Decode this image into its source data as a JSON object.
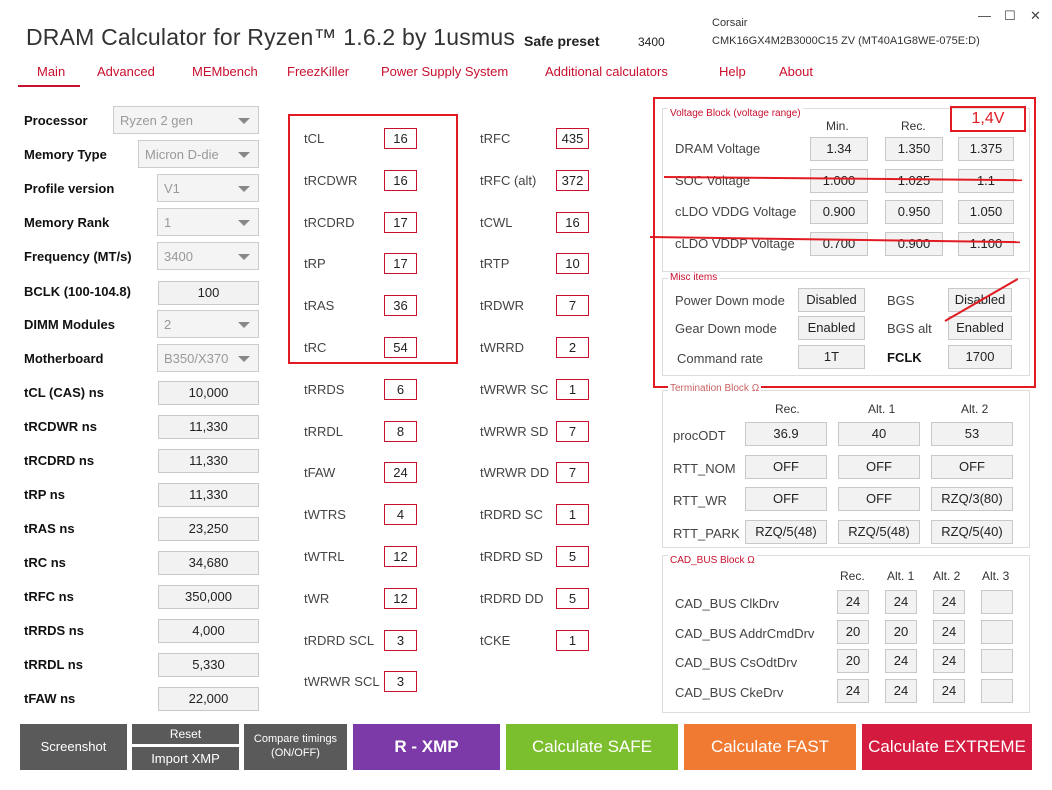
{
  "app": {
    "title": "DRAM Calculator for Ryzen™ 1.6.2 by 1usmus",
    "preset_label": "Safe preset",
    "preset_value": "3400",
    "module_vendor": "Corsair",
    "module_part": "CMK16GX4M2B3000C15  ZV (MT40A1G8WE-075E:D)"
  },
  "window": {
    "minimize": "—",
    "maximize": "☐",
    "close": "✕"
  },
  "tabs": [
    "Main",
    "Advanced",
    "MEMbench",
    "FreezKiller",
    "Power Supply System",
    "Additional calculators",
    "Help",
    "About"
  ],
  "settings": {
    "processor": {
      "label": "Processor",
      "value": "Ryzen 2 gen"
    },
    "memory_type": {
      "label": "Memory Type",
      "value": "Micron D-die"
    },
    "profile_version": {
      "label": "Profile version",
      "value": "V1"
    },
    "memory_rank": {
      "label": "Memory Rank",
      "value": "1"
    },
    "frequency": {
      "label": "Frequency (MT/s)",
      "value": "3400"
    },
    "bclk": {
      "label": "BCLK (100-104.8)",
      "value": "100"
    },
    "dimm_modules": {
      "label": "DIMM Modules",
      "value": "2"
    },
    "motherboard": {
      "label": "Motherboard",
      "value": "B350/X370"
    }
  },
  "ns": [
    {
      "label": "tCL (CAS) ns",
      "value": "10,000"
    },
    {
      "label": "tRCDWR ns",
      "value": "11,330"
    },
    {
      "label": "tRCDRD ns",
      "value": "11,330"
    },
    {
      "label": "tRP ns",
      "value": "11,330"
    },
    {
      "label": "tRAS ns",
      "value": "23,250"
    },
    {
      "label": "tRC ns",
      "value": "34,680"
    },
    {
      "label": "tRFC ns",
      "value": "350,000"
    },
    {
      "label": "tRRDS ns",
      "value": "4,000"
    },
    {
      "label": "tRRDL ns",
      "value": "5,330"
    },
    {
      "label": "tFAW ns",
      "value": "22,000"
    }
  ],
  "timings_col1": [
    {
      "label": "tCL",
      "value": "16"
    },
    {
      "label": "tRCDWR",
      "value": "16"
    },
    {
      "label": "tRCDRD",
      "value": "17"
    },
    {
      "label": "tRP",
      "value": "17"
    },
    {
      "label": "tRAS",
      "value": "36"
    },
    {
      "label": "tRC",
      "value": "54"
    },
    {
      "label": "tRRDS",
      "value": "6"
    },
    {
      "label": "tRRDL",
      "value": "8"
    },
    {
      "label": "tFAW",
      "value": "24"
    },
    {
      "label": "tWTRS",
      "value": "4"
    },
    {
      "label": "tWTRL",
      "value": "12"
    },
    {
      "label": "tWR",
      "value": "12"
    },
    {
      "label": "tRDRD SCL",
      "value": "3"
    },
    {
      "label": "tWRWR SCL",
      "value": "3"
    }
  ],
  "timings_col2": [
    {
      "label": "tRFC",
      "value": "435"
    },
    {
      "label": "tRFC (alt)",
      "value": "372"
    },
    {
      "label": "tCWL",
      "value": "16"
    },
    {
      "label": "tRTP",
      "value": "10"
    },
    {
      "label": "tRDWR",
      "value": "7"
    },
    {
      "label": "tWRRD",
      "value": "2"
    },
    {
      "label": "tWRWR SC",
      "value": "1"
    },
    {
      "label": "tWRWR SD",
      "value": "7"
    },
    {
      "label": "tWRWR DD",
      "value": "7"
    },
    {
      "label": "tRDRD SC",
      "value": "1"
    },
    {
      "label": "tRDRD SD",
      "value": "5"
    },
    {
      "label": "tRDRD DD",
      "value": "5"
    },
    {
      "label": "tCKE",
      "value": "1"
    }
  ],
  "voltage": {
    "title": "Voltage Block (voltage range)",
    "annotation": "1,4V",
    "headers": [
      "Min.",
      "Rec."
    ],
    "rows": [
      {
        "label": "DRAM Voltage",
        "min": "1.34",
        "rec": "1.350",
        "max": "1.375"
      },
      {
        "label": "SOC Voltage",
        "min": "1.000",
        "rec": "1.025",
        "max": "1.1"
      },
      {
        "label": "cLDO VDDG Voltage",
        "min": "0.900",
        "rec": "0.950",
        "max": "1.050"
      },
      {
        "label": "cLDO VDDP Voltage",
        "min": "0.700",
        "rec": "0.900",
        "max": "1.100"
      }
    ]
  },
  "misc": {
    "title": "Misc items",
    "power_down": {
      "label": "Power Down mode",
      "value": "Disabled"
    },
    "bgs": {
      "label": "BGS",
      "value": "Disabled"
    },
    "gear_down": {
      "label": "Gear Down mode",
      "value": "Enabled"
    },
    "bgs_alt": {
      "label": "BGS alt",
      "value": "Enabled"
    },
    "command_rate": {
      "label": "Command rate",
      "value": "1T"
    },
    "fclk": {
      "label": "FCLK",
      "value": "1700"
    }
  },
  "termination": {
    "title": "Termination Block Ω",
    "headers": [
      "Rec.",
      "Alt. 1",
      "Alt. 2"
    ],
    "rows": [
      {
        "label": "procODT",
        "values": [
          "36.9",
          "40",
          "53"
        ]
      },
      {
        "label": "RTT_NOM",
        "values": [
          "OFF",
          "OFF",
          "OFF"
        ]
      },
      {
        "label": "RTT_WR",
        "values": [
          "OFF",
          "OFF",
          "RZQ/3(80)"
        ]
      },
      {
        "label": "RTT_PARK",
        "values": [
          "RZQ/5(48)",
          "RZQ/5(48)",
          "RZQ/5(40)"
        ]
      }
    ]
  },
  "cad": {
    "title": "CAD_BUS Block Ω",
    "headers": [
      "Rec.",
      "Alt. 1",
      "Alt. 2",
      "Alt. 3"
    ],
    "rows": [
      {
        "label": "CAD_BUS ClkDrv",
        "values": [
          "24",
          "24",
          "24",
          ""
        ]
      },
      {
        "label": "CAD_BUS AddrCmdDrv",
        "values": [
          "20",
          "20",
          "24",
          ""
        ]
      },
      {
        "label": "CAD_BUS CsOdtDrv",
        "values": [
          "20",
          "24",
          "24",
          ""
        ]
      },
      {
        "label": "CAD_BUS CkeDrv",
        "values": [
          "24",
          "24",
          "24",
          ""
        ]
      }
    ]
  },
  "buttons": {
    "screenshot": "Screenshot",
    "reset": "Reset",
    "import_xmp": "Import XMP",
    "compare_line1": "Compare timings",
    "compare_line2": "(ON/OFF)",
    "r_xmp": "R - XMP",
    "calc_safe": "Calculate SAFE",
    "calc_fast": "Calculate FAST",
    "calc_extreme": "Calculate EXTREME"
  },
  "colors": {
    "accent": "#c8102e",
    "annotation_red": "#e21b23",
    "btn_gray": "#5a5a5a",
    "btn_purple": "#7b3aa8",
    "btn_green": "#7cbf2e",
    "btn_orange": "#f07a32",
    "btn_red": "#d41a3f"
  }
}
